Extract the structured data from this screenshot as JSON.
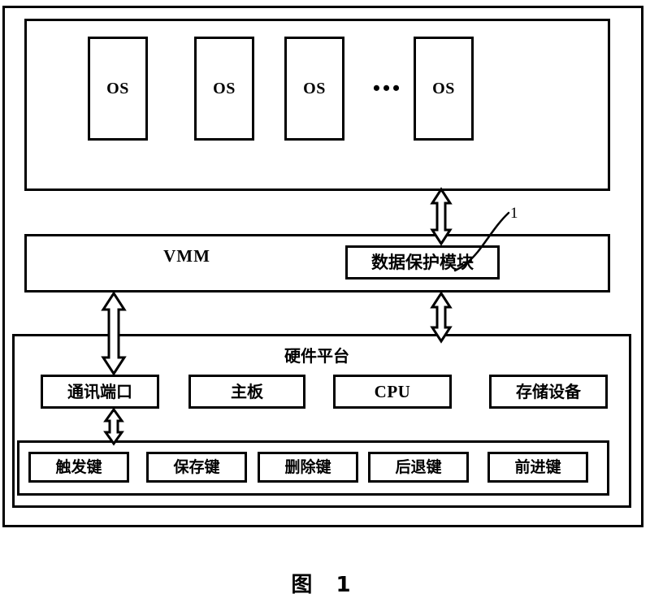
{
  "figure": {
    "caption": "图 1",
    "callout_label": "1"
  },
  "vm_layer": {
    "name": "virtual-machine-layer",
    "os_boxes": [
      {
        "label": "OS"
      },
      {
        "label": "OS"
      },
      {
        "label": "OS"
      },
      {
        "label": "OS"
      }
    ],
    "ellipsis": "•••"
  },
  "vmm_layer": {
    "title": "VMM",
    "data_protection_module": "数据保护模块"
  },
  "hardware_platform": {
    "title": "硬件平台",
    "components": [
      {
        "label": "通讯端口"
      },
      {
        "label": "主板"
      },
      {
        "label": "CPU"
      },
      {
        "label": "存储设备"
      }
    ],
    "keys": [
      {
        "label": "触发键"
      },
      {
        "label": "保存键"
      },
      {
        "label": "删除键"
      },
      {
        "label": "后退键"
      },
      {
        "label": "前进键"
      }
    ]
  },
  "colors": {
    "line": "#000000",
    "background": "#ffffff"
  }
}
